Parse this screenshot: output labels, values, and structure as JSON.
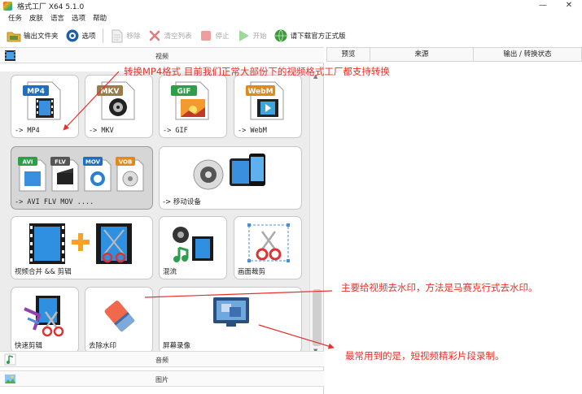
{
  "window": {
    "title": "格式工厂 X64 5.1.0",
    "minimize": "—",
    "close": "✕"
  },
  "menu": [
    "任务",
    "皮肤",
    "语言",
    "选项",
    "帮助"
  ],
  "toolbar": {
    "output_folder": "输出文件夹",
    "options": "选项",
    "remove": "移除",
    "clear_list": "清空列表",
    "stop": "停止",
    "start": "开始",
    "download_official": "请下载官方正式版"
  },
  "sections": {
    "video": "视频",
    "audio": "音频",
    "image": "图片"
  },
  "tiles": {
    "mp4": {
      "label": "-> MP4",
      "badge": "MP4"
    },
    "mkv": {
      "label": "-> MKV",
      "badge": "MKV"
    },
    "gif": {
      "label": "-> GIF",
      "badge": "GIF"
    },
    "webm": {
      "label": "-> WebM",
      "badge": "WebM"
    },
    "avi_flv_mov": {
      "label": "-> AVI FLV MOV ....",
      "badges": [
        "AVI",
        "FLV",
        "MOV",
        "VOB"
      ]
    },
    "mobile": {
      "label": "-> 移动设备"
    },
    "join_cut": {
      "label": "视频合并 && 剪辑"
    },
    "mix": {
      "label": "混流"
    },
    "crop": {
      "label": "画面裁剪"
    },
    "quick_clip": {
      "label": "快速剪辑"
    },
    "remove_watermark": {
      "label": "去除水印"
    },
    "screen_record": {
      "label": "屏幕录像"
    }
  },
  "right_headers": {
    "preview": "预览",
    "source": "来源",
    "output_status": "输出 / 转换状态"
  },
  "annotations": {
    "mp4": "转换MP4格式  目前我们正常大部份下的视频格式工厂都支持转换",
    "watermark": "主要给视频去水印，方法是马赛克行式去水印。",
    "record": "最常用到的是，短视频精彩片段录制。"
  },
  "colors": {
    "annotation": "#e8302a",
    "mp4_badge": "#1f6fbf",
    "mkv_badge": "#9c7a4a",
    "gif_badge": "#2e9e4a",
    "webm_badge": "#e08a1e"
  }
}
